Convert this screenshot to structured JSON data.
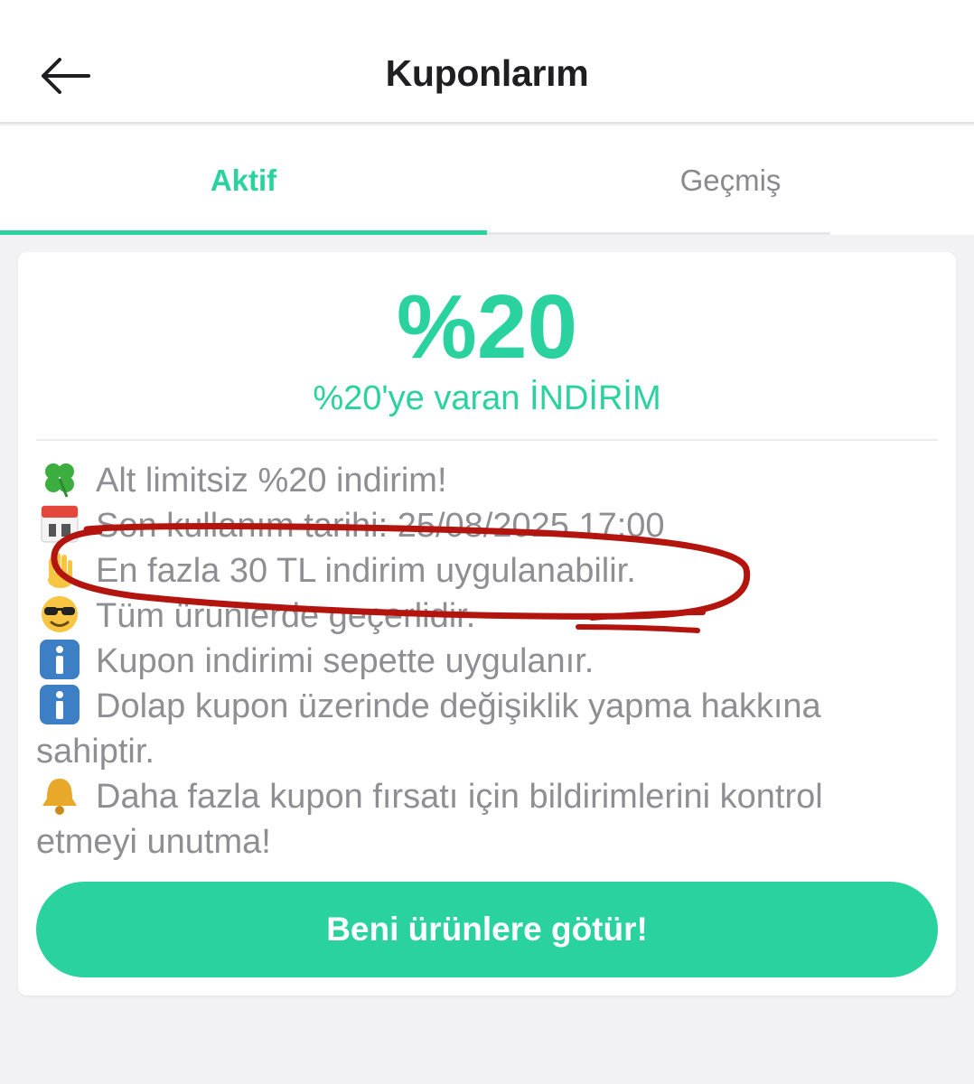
{
  "header": {
    "title": "Kuponlarım",
    "back_icon": "arrow-left-icon"
  },
  "tabs": [
    {
      "label": "Aktif",
      "active": true
    },
    {
      "label": "Geçmiş",
      "active": false
    }
  ],
  "coupon": {
    "amount": "%20",
    "subtitle": "%20'ye varan İNDİRİM",
    "details": [
      {
        "icon": "four-leaf-clover-icon",
        "text": "Alt limitsiz %20 indirim!"
      },
      {
        "icon": "calendar-icon",
        "text": "Son kullanım tarihi: 25/08/2025 17:00"
      },
      {
        "icon": "raised-hand-icon",
        "text": "En fazla 30 TL indirim uygulanabilir."
      },
      {
        "icon": "sunglasses-face-icon",
        "text": "Tüm ürünlerde geçerlidir."
      },
      {
        "icon": "info-icon",
        "text": "Kupon indirimi sepette uygulanır."
      },
      {
        "icon": "info-icon",
        "text": "Dolap kupon üzerinde değişiklik yapma hakkına sahiptir."
      },
      {
        "icon": "bell-icon",
        "text": "Daha fazla kupon fırsatı için bildirimlerini kontrol etmeyi unutma!"
      }
    ],
    "cta_label": "Beni ürünlere götür!"
  },
  "colors": {
    "accent": "#2ad2a0",
    "muted_text": "#8e8e93",
    "annotation": "#b3140e"
  }
}
